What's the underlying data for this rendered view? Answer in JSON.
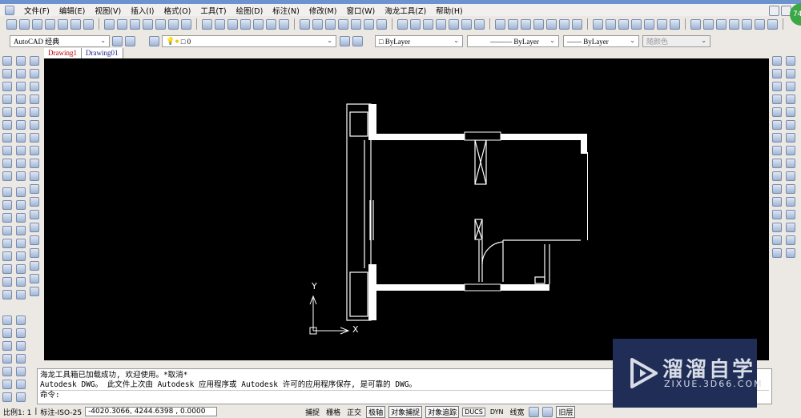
{
  "menu": [
    "文件(F)",
    "编辑(E)",
    "视图(V)",
    "插入(I)",
    "格式(O)",
    "工具(T)",
    "绘图(D)",
    "标注(N)",
    "修改(M)",
    "窗口(W)",
    "海龙工具(Z)",
    "帮助(H)"
  ],
  "workspace": "AutoCAD 经典",
  "layer": "0",
  "color": "ByLayer",
  "linetype": "ByLayer",
  "lineweight": "ByLayer",
  "plotstyle": "随颜色",
  "tabs": [
    "Drawing1",
    "Drawing01"
  ],
  "badge": "74",
  "ucs": {
    "x": "X",
    "y": "Y"
  },
  "command": {
    "line1": "海龙工具箱已加载成功, 欢迎使用。*取消*",
    "line2": "Autodesk DWG。  此文件上次由 Autodesk 应用程序或 Autodesk 许可的应用程序保存, 是可靠的 DWG。",
    "prompt": "命令:"
  },
  "status": {
    "scale": "比例1: 1",
    "dimstyle": "标注-ISO-25",
    "coords": "-4020.3066, 4244.6398 , 0.0000",
    "buttons": [
      "捕捉",
      "栅格",
      "正交",
      "极轴",
      "对象捕捉",
      "对象追踪",
      "DUCS",
      "DYN",
      "线宽"
    ],
    "layer": "旧层"
  },
  "watermark": {
    "name": "溜溜自学",
    "url": "ZIXUE.3D66.COM"
  }
}
